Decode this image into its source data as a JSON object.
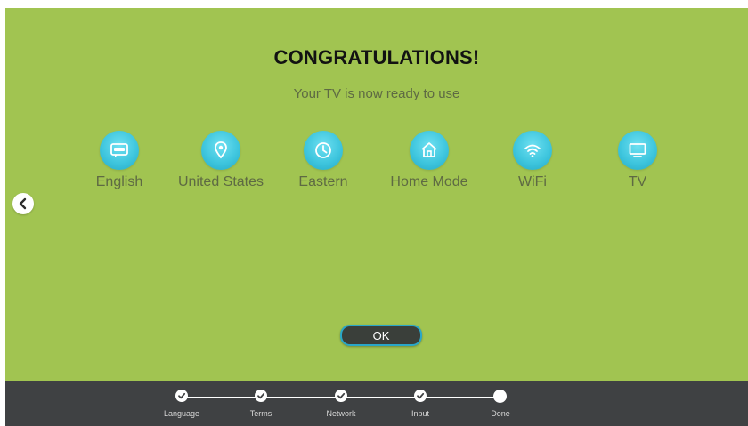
{
  "header": {
    "title": "CONGRATULATIONS!",
    "subtitle": "Your TV is now ready to use"
  },
  "summary": {
    "items": [
      {
        "label": "English",
        "icon": "language-icon"
      },
      {
        "label": "United States",
        "icon": "location-pin-icon"
      },
      {
        "label": "Eastern",
        "icon": "clock-icon"
      },
      {
        "label": "Home Mode",
        "icon": "home-icon"
      },
      {
        "label": "WiFi",
        "icon": "wifi-icon"
      },
      {
        "label": "TV",
        "icon": "tv-icon"
      }
    ]
  },
  "actions": {
    "ok_label": "OK",
    "back_icon": "chevron-left-icon"
  },
  "progress": {
    "steps": [
      {
        "label": "Language",
        "state": "completed"
      },
      {
        "label": "Terms",
        "state": "completed"
      },
      {
        "label": "Network",
        "state": "completed"
      },
      {
        "label": "Input",
        "state": "completed"
      },
      {
        "label": "Done",
        "state": "current"
      }
    ]
  },
  "colors": {
    "background": "#a1c451",
    "icon_bubble": "#3fc6de",
    "footer": "#3f4143",
    "button_border": "#29a7c8"
  }
}
